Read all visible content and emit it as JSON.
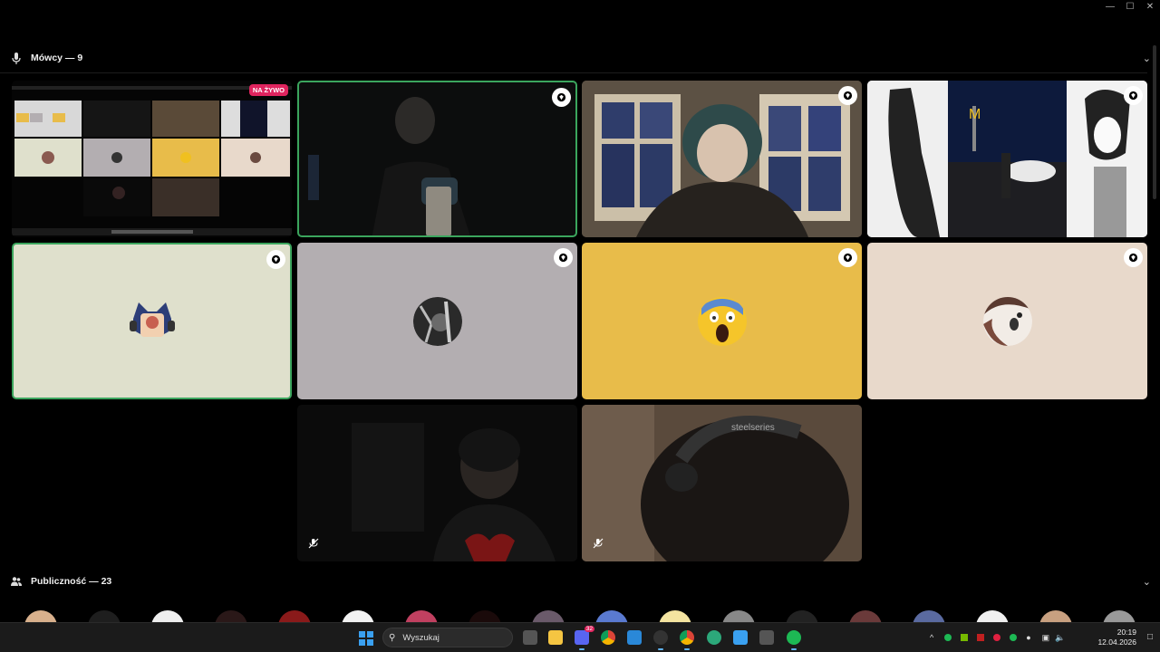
{
  "speakers": {
    "title": "Mówcy — 9",
    "tiles": [
      {
        "kind": "screen",
        "live_label": "NA ŻYWO"
      },
      {
        "kind": "video",
        "speaking": true,
        "shield": true
      },
      {
        "kind": "video",
        "shield": true
      },
      {
        "kind": "video",
        "shield": true
      },
      {
        "kind": "avatar",
        "speaking": true,
        "shield": true,
        "bg": "#dfe0cc",
        "avatar": "fox-mascot-icon"
      },
      {
        "kind": "avatar",
        "shield": true,
        "bg": "#b3aeb1",
        "avatar": "dark-profile-icon"
      },
      {
        "kind": "avatar",
        "shield": true,
        "bg": "#e8bc4a",
        "avatar": "screaming-emoji-icon"
      },
      {
        "kind": "avatar",
        "shield": true,
        "bg": "#e8d9cb",
        "avatar": "anime-profile-icon"
      },
      {
        "kind": "video",
        "muted": true
      },
      {
        "kind": "video",
        "muted": true
      }
    ]
  },
  "audience": {
    "title": "Publiczność — 23"
  },
  "taskbar": {
    "search_placeholder": "Wyszukaj",
    "time": "20:19",
    "date": "12.04.2026",
    "discord_badge": "32",
    "apps": [
      "task-view",
      "file-explorer",
      "discord",
      "chrome",
      "photos",
      "obs",
      "chrome-profile",
      "edge",
      "notepad",
      "calculator",
      "spotify"
    ]
  },
  "colors": {
    "speaking_border": "#3ba55d",
    "live_badge": "#e0245e",
    "taskbar": "#1b1b1b"
  }
}
